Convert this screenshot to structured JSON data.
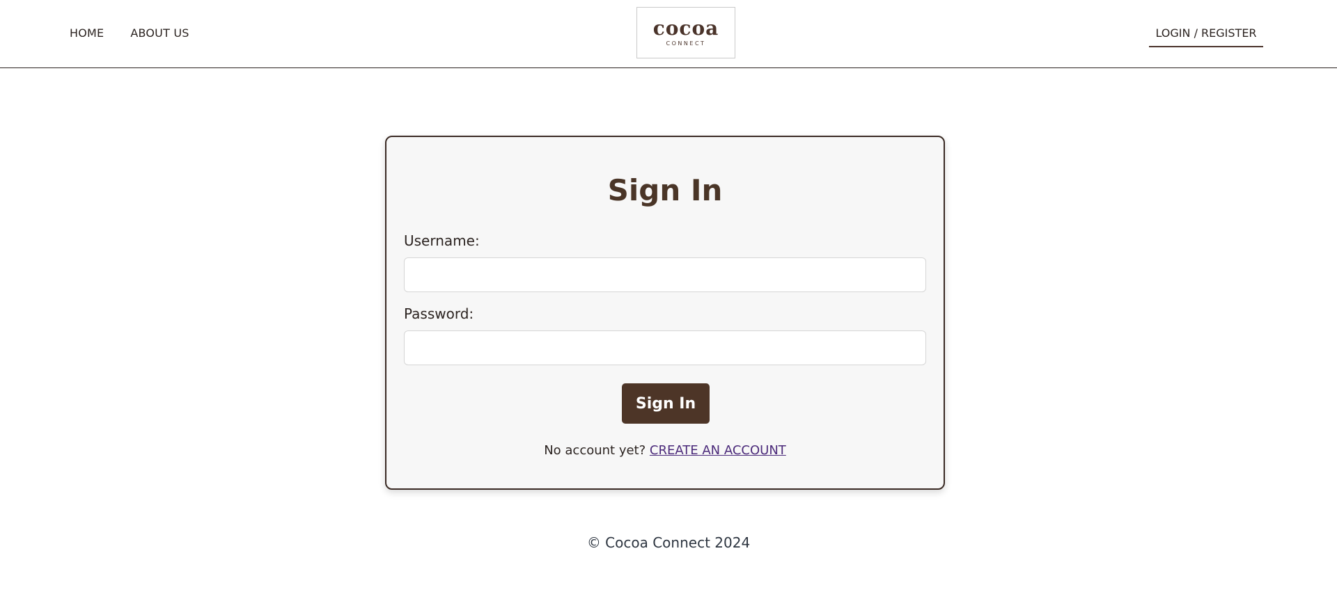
{
  "header": {
    "nav_left": [
      {
        "label": "HOME"
      },
      {
        "label": "ABOUT US"
      }
    ],
    "logo": {
      "word": "cocoa",
      "sub": "CONNECT"
    },
    "nav_right_label": "LOGIN / REGISTER"
  },
  "signin_card": {
    "title": "Sign In",
    "username_label": "Username:",
    "username_value": "",
    "password_label": "Password:",
    "password_value": "",
    "submit_label": "Sign In",
    "no_account_text": "No account yet?",
    "create_account_label": "CREATE AN ACCOUNT"
  },
  "footer": {
    "text": "© Cocoa Connect 2024"
  },
  "colors": {
    "brand_brown": "#4d3527",
    "border_dark": "#2b2320",
    "card_bg": "#f7f7f7",
    "link_purple": "#4b2a7a"
  }
}
